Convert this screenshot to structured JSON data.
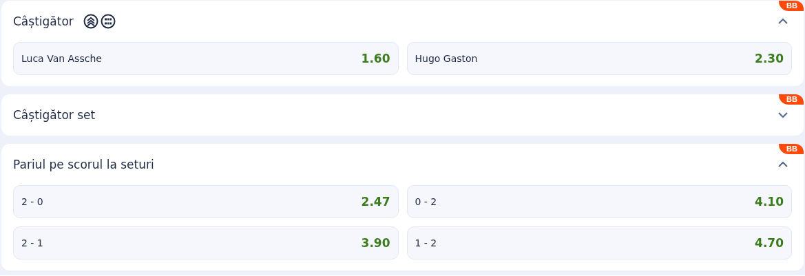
{
  "markets": [
    {
      "title": "Câștigător",
      "badge": "BB",
      "expanded": true,
      "icons": [
        {
          "kind": "boost"
        },
        {
          "kind": "score"
        }
      ],
      "rows": [
        [
          {
            "label": "Luca Van Assche",
            "odds": "1.60"
          },
          {
            "label": "Hugo Gaston",
            "odds": "2.30"
          }
        ]
      ]
    },
    {
      "title": "Câștigător set",
      "badge": "BB",
      "expanded": false
    },
    {
      "title": "Pariul pe scorul la seturi",
      "badge": "BB",
      "expanded": true,
      "rows": [
        [
          {
            "label": "2 - 0",
            "odds": "2.47"
          },
          {
            "label": "0 - 2",
            "odds": "4.10"
          }
        ],
        [
          {
            "label": "2 - 1",
            "odds": "3.90"
          },
          {
            "label": "1 - 2",
            "odds": "4.70"
          }
        ]
      ]
    }
  ]
}
